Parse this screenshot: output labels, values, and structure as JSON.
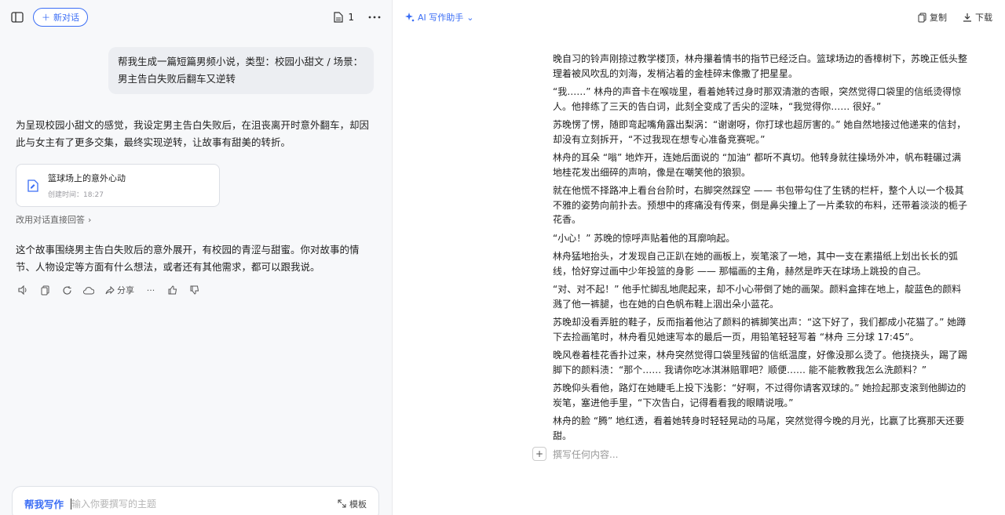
{
  "left_header": {
    "new_chat_label": "新对话",
    "doc_count": "1"
  },
  "user_message": "帮我生成一篇短篇男频小说，类型：校园小甜文 / 场景：男主告白失败后翻车又逆转",
  "ai_intro": "为呈现校园小甜文的感觉，我设定男主告白失败后，在沮丧离开时意外翻车，却因此与女主有了更多交集，最终实现逆转，让故事有甜美的转折。",
  "doc_card": {
    "title": "篮球场上的意外心动",
    "created": "创建时间：18:27"
  },
  "reply_link": "改用对话直接回答",
  "ai_followup": "这个故事围绕男主告白失败后的意外展开，有校园的青涩与甜蜜。你对故事的情节、人物设定等方面有什么想法，或者还有其他需求，都可以跟我说。",
  "actions": {
    "share_label": "分享"
  },
  "composer": {
    "mode": "帮我写作",
    "placeholder": "输入你要撰写的主题",
    "template_label": "模板"
  },
  "right_header": {
    "assistant_label": "AI 写作助手",
    "copy_label": "复制",
    "download_label": "下载"
  },
  "story": [
    "晚自习的铃声刚掠过教学楼顶，林舟攥着情书的指节已经泛白。篮球场边的香樟树下，苏晚正低头整理着被风吹乱的刘海，发梢沾着的金桂碎末像撒了把星星。",
    "“我……” 林舟的声音卡在喉咙里，看着她转过身时那双清澈的杏眼，突然觉得口袋里的信纸烫得惊人。他排练了三天的告白词，此刻全变成了舌尖的涩味，“我觉得你…… 很好。”",
    "苏晚愣了愣，随即弯起嘴角露出梨涡：“谢谢呀，你打球也超厉害的。” 她自然地接过他递来的信封，却没有立刻拆开，“不过我现在想专心准备竞赛呢。”",
    "林舟的耳朵 “嗡” 地炸开，连她后面说的 “加油” 都听不真切。他转身就往操场外冲，帆布鞋碾过满地桂花发出细碎的声响，像是在嘲笑他的狼狈。",
    "就在他慌不择路冲上看台台阶时，右脚突然踩空 —— 书包带勾住了生锈的栏杆，整个人以一个极其不雅的姿势向前扑去。预想中的疼痛没有传来，倒是鼻尖撞上了一片柔软的布料，还带着淡淡的栀子花香。",
    "“小心！” 苏晚的惊呼声贴着他的耳廓响起。",
    "林舟猛地抬头，才发现自己正趴在她的画板上，炭笔滚了一地，其中一支在素描纸上划出长长的弧线，恰好穿过画中少年投篮的身影 —— 那幅画的主角，赫然是昨天在球场上跳投的自己。",
    "“对、对不起！” 他手忙脚乱地爬起来，却不小心带倒了她的画架。颜料盒摔在地上，靛蓝色的颜料溅了他一裤腿，也在她的白色帆布鞋上洇出朵小蓝花。",
    "苏晚却没看弄脏的鞋子，反而指着他沾了颜料的裤脚笑出声：“这下好了，我们都成小花猫了。” 她蹲下去捡画笔时，林舟看见她速写本的最后一页，用铅笔轻轻写着 “林舟 三分球 17:45”。",
    "晚风卷着桂花香扑过来，林舟突然觉得口袋里残留的信纸温度，好像没那么烫了。他挠挠头，踢了踢脚下的颜料渍：“那个…… 我请你吃冰淇淋赔罪吧？顺便…… 能不能教教我怎么洗颜料？”",
    "苏晚仰头看他，路灯在她睫毛上投下浅影：“好啊，不过得你请客双球的。” 她捡起那支滚到他脚边的炭笔，塞进他手里，“下次告白，记得看看我的眼睛说哦。”",
    "林舟的脸 “腾” 地红透，看着她转身时轻轻晃动的马尾，突然觉得今晚的月光，比赢了比赛那天还要甜。"
  ],
  "write_more_placeholder": "撰写任何内容..."
}
